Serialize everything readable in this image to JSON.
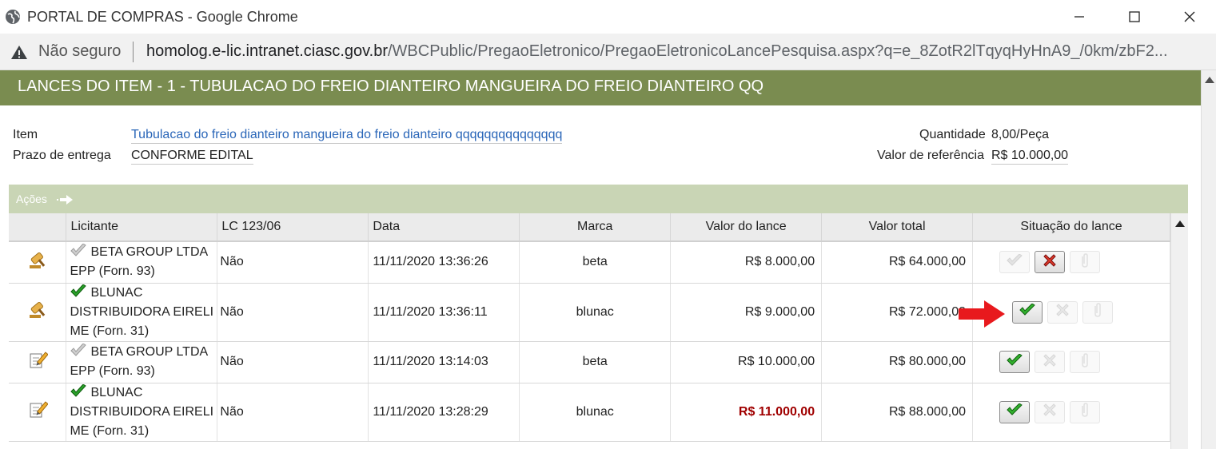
{
  "browser": {
    "window_title": "PORTAL DE COMPRAS - Google Chrome",
    "security_label": "Não seguro",
    "url_host": "homolog.e-lic.intranet.ciasc.gov.br",
    "url_path": "/WBCPublic/PregaoEletronico/PregaoEletronicoLancePesquisa.aspx?q=e_8ZotR2lTqyqHyHnA9_/0km/zbF2..."
  },
  "header": {
    "title": "LANCES DO ITEM - 1 - TUBULACAO DO FREIO DIANTEIRO MANGUEIRA DO FREIO DIANTEIRO QQ"
  },
  "info": {
    "item_label": "Item",
    "item_value": "Tubulacao do freio dianteiro mangueira do freio dianteiro qqqqqqqqqqqqqqq",
    "prazo_label": "Prazo de entrega",
    "prazo_value": "CONFORME EDITAL",
    "quantidade_label": "Quantidade",
    "quantidade_value": "8,00/Peça",
    "valor_ref_label": "Valor de referência",
    "valor_ref_value": "R$ 10.000,00"
  },
  "actions": {
    "label": "Ações"
  },
  "table": {
    "columns": [
      "Licitante",
      "LC 123/06",
      "Data",
      "Marca",
      "Valor do lance",
      "Valor total",
      "Situação do lance"
    ],
    "rows": [
      {
        "row_icon": "gavel-icon",
        "check": "gray",
        "licitante_l1": "BETA GROUP LTDA",
        "licitante_l2": "EPP (Forn. 93)",
        "licitante_l3": "",
        "lc": "Não",
        "data": "11/11/2020 13:36:26",
        "marca": "beta",
        "valor_lance": "R$ 8.000,00",
        "valor_total": "R$ 64.000,00",
        "lance_highlight": false,
        "accept_state": "disabled",
        "reject_state": "active"
      },
      {
        "row_icon": "gavel-icon",
        "check": "green",
        "licitante_l1": "BLUNAC",
        "licitante_l2": "DISTRIBUIDORA EIRELI",
        "licitante_l3": "ME (Forn. 31)",
        "lc": "Não",
        "data": "11/11/2020 13:36:11",
        "marca": "blunac",
        "valor_lance": "R$ 9.000,00",
        "valor_total": "R$ 72.000,00",
        "lance_highlight": false,
        "accept_state": "active",
        "reject_state": "disabled"
      },
      {
        "row_icon": "edit-icon",
        "check": "gray",
        "licitante_l1": "BETA GROUP LTDA",
        "licitante_l2": "EPP (Forn. 93)",
        "licitante_l3": "",
        "lc": "Não",
        "data": "11/11/2020 13:14:03",
        "marca": "beta",
        "valor_lance": "R$ 10.000,00",
        "valor_total": "R$ 80.000,00",
        "lance_highlight": false,
        "accept_state": "active",
        "reject_state": "disabled"
      },
      {
        "row_icon": "edit-icon",
        "check": "green",
        "licitante_l1": "BLUNAC",
        "licitante_l2": "DISTRIBUIDORA EIRELI",
        "licitante_l3": "ME (Forn. 31)",
        "lc": "Não",
        "data": "11/11/2020 13:28:29",
        "marca": "blunac",
        "valor_lance": "R$ 11.000,00",
        "valor_total": "R$ 88.000,00",
        "lance_highlight": true,
        "accept_state": "active",
        "reject_state": "disabled"
      }
    ]
  },
  "colors": {
    "header_bg": "#7a8c50",
    "actions_bg": "#c9d5b5",
    "link": "#2a66b8",
    "highlight_value": "#a00000",
    "pointer_arrow": "#e8191d"
  }
}
